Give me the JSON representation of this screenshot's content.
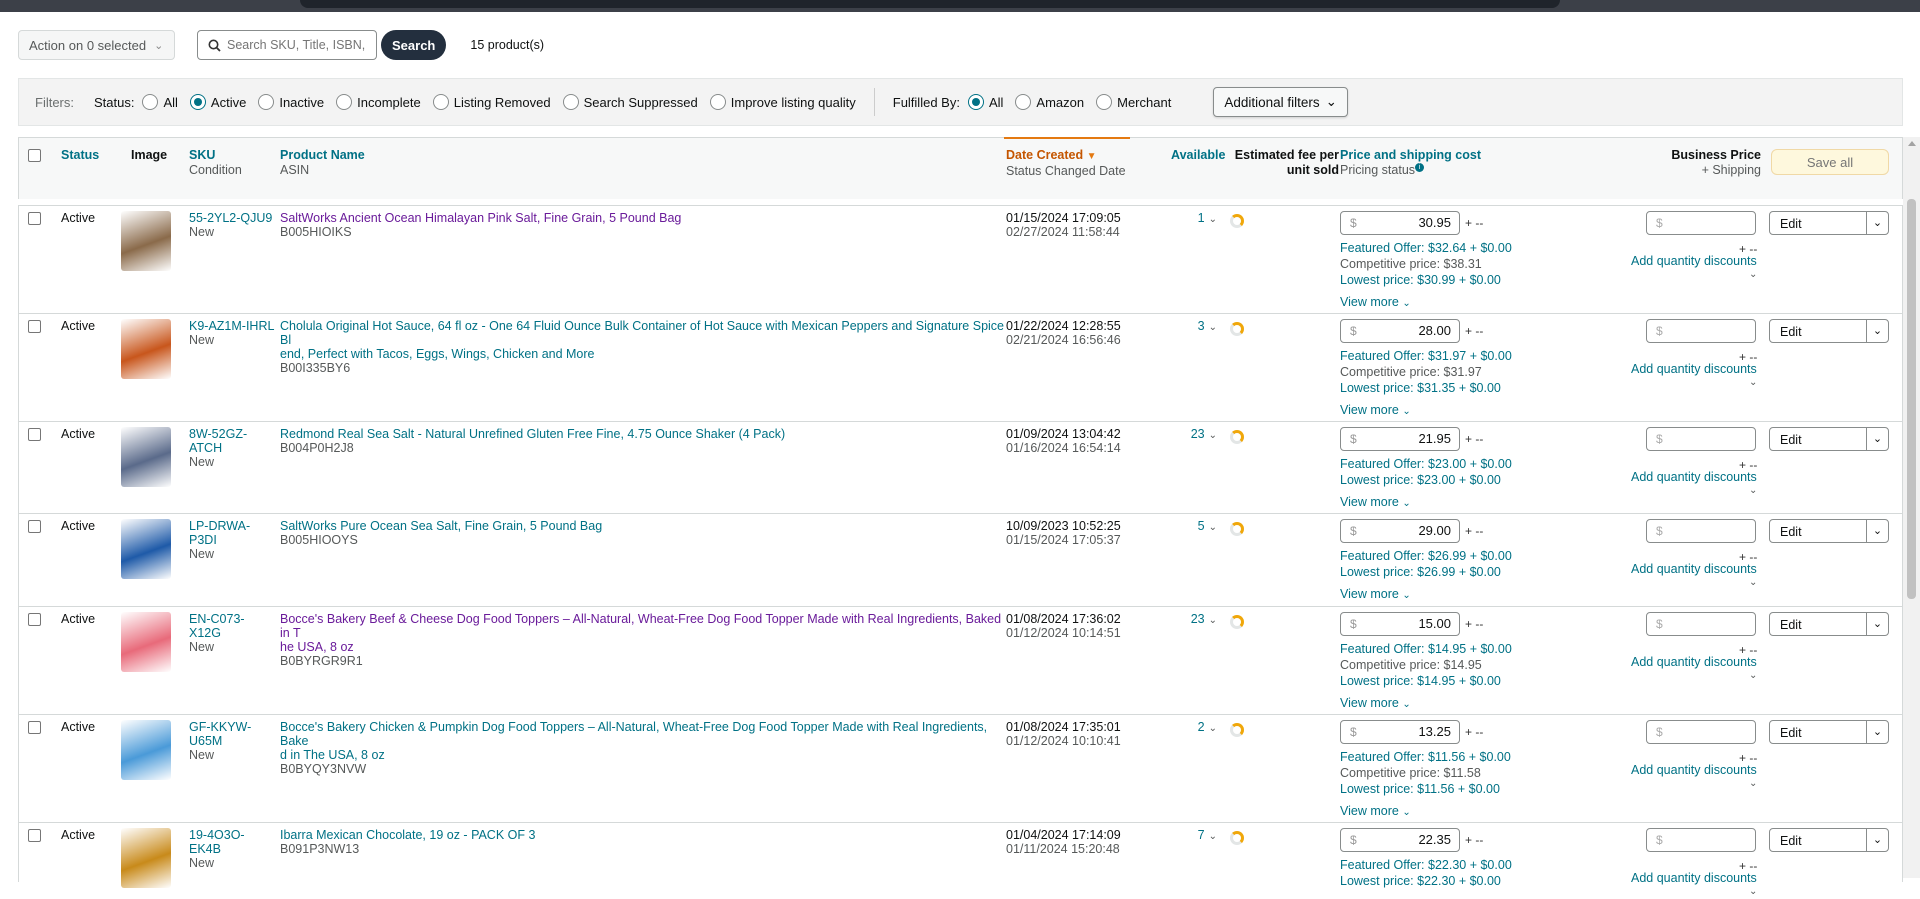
{
  "toolbar": {
    "action_label": "Action on 0 selected",
    "search_placeholder": "Search SKU, Title, ISBN,",
    "search_button": "Search",
    "product_count": "15 product(s)"
  },
  "filters": {
    "label": "Filters:",
    "status_label": "Status:",
    "status_options": [
      "All",
      "Active",
      "Inactive",
      "Incomplete",
      "Listing Removed",
      "Search Suppressed",
      "Improve listing quality"
    ],
    "status_selected": "Active",
    "fulfilled_label": "Fulfilled By:",
    "fulfilled_options": [
      "All",
      "Amazon",
      "Merchant"
    ],
    "fulfilled_selected": "All",
    "additional_filters": "Additional filters"
  },
  "table_header": {
    "status": "Status",
    "image": "Image",
    "sku": "SKU",
    "condition": "Condition",
    "product_name": "Product Name",
    "asin": "ASIN",
    "date_created": "Date Created",
    "status_changed_date": "Status Changed Date",
    "available": "Available",
    "est_fee_line1": "Estimated fee per",
    "est_fee_line2": "unit sold",
    "price_shipping": "Price and shipping cost",
    "pricing_status": "Pricing status",
    "business_price": "Business Price",
    "plus_shipping": "+ Shipping",
    "save_all": "Save all"
  },
  "common": {
    "edit": "Edit",
    "view_more": "View more",
    "add_qty_discounts": "Add quantity discounts",
    "plus_dash": "+ --",
    "dollar": "$"
  },
  "products": [
    {
      "status": "Active",
      "sku_line1": "55-2YL2-QJU9",
      "sku_line2": "",
      "condition": "New",
      "name_line1": "SaltWorks Ancient Ocean Himalayan Pink Salt, Fine Grain, 5 Pound Bag",
      "name_line2": "",
      "asin": "B005HIOIKS",
      "date_created": "01/15/2024 17:09:05",
      "status_changed": "02/27/2024 11:58:44",
      "available": "1",
      "price": "30.95",
      "featured": "Featured Offer: $32.64 + $0.00",
      "competitive": "Competitive price: $38.31",
      "lowest": "Lowest price: $30.99 + $0.00",
      "image_color": "#8a6a4a"
    },
    {
      "status": "Active",
      "sku_line1": "K9-AZ1M-IHRL",
      "sku_line2": "",
      "condition": "New",
      "name_line1": "Cholula Original Hot Sauce, 64 fl oz - One 64 Fluid Ounce Bulk Container of Hot Sauce with Mexican Peppers and Signature Spice Bl",
      "name_line2": "end, Perfect with Tacos, Eggs, Wings, Chicken and More",
      "asin": "B00I335BY6",
      "date_created": "01/22/2024 12:28:55",
      "status_changed": "02/21/2024 16:56:46",
      "available": "3",
      "price": "28.00",
      "featured": "Featured Offer: $31.97 + $0.00",
      "competitive": "Competitive price: $31.97",
      "lowest": "Lowest price: $31.35 + $0.00",
      "image_color": "#c8561c"
    },
    {
      "status": "Active",
      "sku_line1": "8W-52GZ-",
      "sku_line2": "ATCH",
      "condition": "New",
      "name_line1": "Redmond Real Sea Salt - Natural Unrefined Gluten Free Fine, 4.75 Ounce Shaker (4 Pack)",
      "name_line2": "",
      "asin": "B004P0H2J8",
      "date_created": "01/09/2024 13:04:42",
      "status_changed": "01/16/2024 16:54:14",
      "available": "23",
      "price": "21.95",
      "featured": "Featured Offer: $23.00 + $0.00",
      "competitive": "",
      "lowest": "Lowest price: $23.00 + $0.00",
      "image_color": "#5a6a8a"
    },
    {
      "status": "Active",
      "sku_line1": "LP-DRWA-",
      "sku_line2": "P3DI",
      "condition": "New",
      "name_line1": "SaltWorks Pure Ocean Sea Salt, Fine Grain, 5 Pound Bag",
      "name_line2": "",
      "asin": "B005HIOOYS",
      "date_created": "10/09/2023 10:52:25",
      "status_changed": "01/15/2024 17:05:37",
      "available": "5",
      "price": "29.00",
      "featured": "Featured Offer: $26.99 + $0.00",
      "competitive": "",
      "lowest": "Lowest price: $26.99 + $0.00",
      "image_color": "#1e5aa8"
    },
    {
      "status": "Active",
      "sku_line1": "EN-C073-",
      "sku_line2": "X12G",
      "condition": "New",
      "name_line1": "Bocce's Bakery Beef & Cheese Dog Food Toppers – All-Natural, Wheat-Free Dog Food Topper Made with Real Ingredients, Baked in T",
      "name_line2": "he USA, 8 oz",
      "asin": "B0BYRGR9R1",
      "date_created": "01/08/2024 17:36:02",
      "status_changed": "01/12/2024 10:14:51",
      "available": "23",
      "price": "15.00",
      "featured": "Featured Offer: $14.95 + $0.00",
      "competitive": "Competitive price: $14.95",
      "lowest": "Lowest price: $14.95 + $0.00",
      "image_color": "#e86a7a"
    },
    {
      "status": "Active",
      "sku_line1": "GF-KKYW-",
      "sku_line2": "U65M",
      "condition": "New",
      "name_line1": "Bocce's Bakery Chicken & Pumpkin Dog Food Toppers – All-Natural, Wheat-Free Dog Food Topper Made with Real Ingredients, Bake",
      "name_line2": "d in The USA, 8 oz",
      "asin": "B0BYQY3NVW",
      "date_created": "01/08/2024 17:35:01",
      "status_changed": "01/12/2024 10:10:41",
      "available": "2",
      "price": "13.25",
      "featured": "Featured Offer: $11.56 + $0.00",
      "competitive": "Competitive price: $11.58",
      "lowest": "Lowest price: $11.56 + $0.00",
      "image_color": "#4a9ad8"
    },
    {
      "status": "Active",
      "sku_line1": "19-4O3O-",
      "sku_line2": "EK4B",
      "condition": "New",
      "name_line1": "Ibarra Mexican Chocolate, 19 oz - PACK OF 3",
      "name_line2": "",
      "asin": "B091P3NW13",
      "date_created": "01/04/2024 17:14:09",
      "status_changed": "01/11/2024 15:20:48",
      "available": "7",
      "price": "22.35",
      "featured": "Featured Offer: $22.30 + $0.00",
      "competitive": "",
      "lowest": "Lowest price: $22.30 + $0.00",
      "image_color": "#c88a1a"
    }
  ]
}
